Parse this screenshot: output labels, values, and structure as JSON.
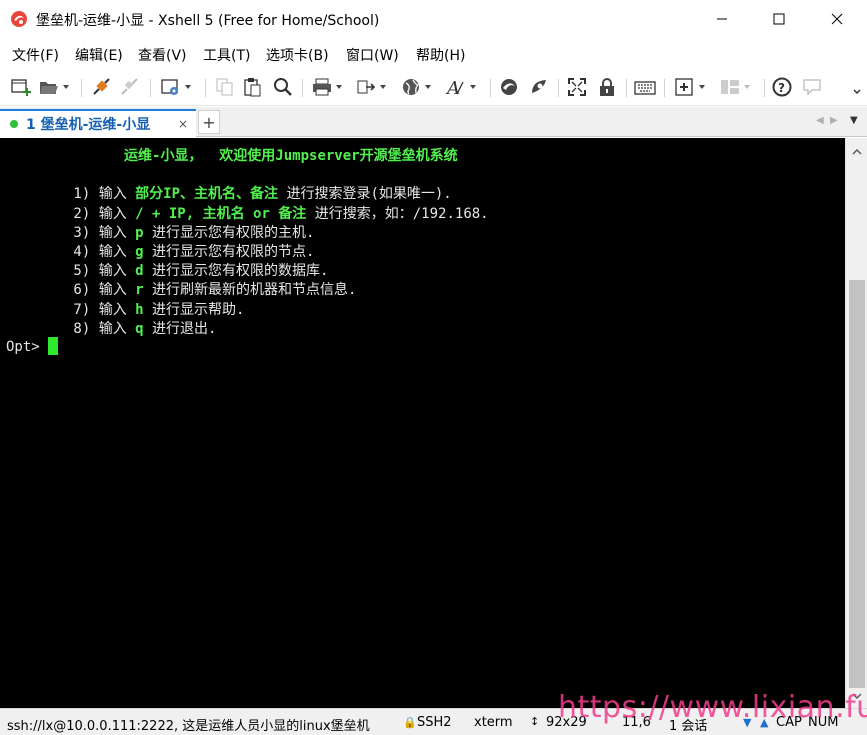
{
  "window": {
    "title": "堡垒机-运维-小显 - Xshell 5 (Free for Home/School)",
    "icon": "xshell-logo-icon"
  },
  "menu": {
    "items": [
      "文件(F)",
      "编辑(E)",
      "查看(V)",
      "工具(T)",
      "选项卡(B)",
      "窗口(W)",
      "帮助(H)"
    ]
  },
  "tabs": {
    "active_label": "1 堡垒机-运维-小显",
    "close_glyph": "×",
    "add_glyph": "+",
    "status_color": "#2dbe3c"
  },
  "terminal": {
    "lines": [
      [
        {
          "t": "              ",
          "h": false
        },
        {
          "t": "运维-小显，  欢迎使用Jumpserver开源堡垒机系统",
          "h": true
        }
      ],
      [],
      [
        {
          "t": "        1) 输入 ",
          "h": false
        },
        {
          "t": "部分IP、主机名、备注",
          "h": true
        },
        {
          "t": " 进行搜索登录(如果唯一).",
          "h": false
        }
      ],
      [
        {
          "t": "        2) 输入 ",
          "h": false
        },
        {
          "t": "/ + IP, 主机名 or 备注",
          "h": true
        },
        {
          "t": " 进行搜索，如：/192.168.",
          "h": false
        }
      ],
      [
        {
          "t": "        3) 输入 ",
          "h": false
        },
        {
          "t": "p",
          "h": true
        },
        {
          "t": " 进行显示您有权限的主机.",
          "h": false
        }
      ],
      [
        {
          "t": "        4) 输入 ",
          "h": false
        },
        {
          "t": "g",
          "h": true
        },
        {
          "t": " 进行显示您有权限的节点.",
          "h": false
        }
      ],
      [
        {
          "t": "        5) 输入 ",
          "h": false
        },
        {
          "t": "d",
          "h": true
        },
        {
          "t": " 进行显示您有权限的数据库.",
          "h": false
        }
      ],
      [
        {
          "t": "        6) 输入 ",
          "h": false
        },
        {
          "t": "r",
          "h": true
        },
        {
          "t": " 进行刷新最新的机器和节点信息.",
          "h": false
        }
      ],
      [
        {
          "t": "        7) 输入 ",
          "h": false
        },
        {
          "t": "h",
          "h": true
        },
        {
          "t": " 进行显示帮助.",
          "h": false
        }
      ],
      [
        {
          "t": "        8) 输入 ",
          "h": false
        },
        {
          "t": "q",
          "h": true
        },
        {
          "t": " 进行退出.",
          "h": false
        }
      ],
      [
        {
          "t": "Opt> ",
          "h": false
        }
      ]
    ],
    "colors": {
      "background": "#000000",
      "foreground": "#e6e6e6",
      "highlight": "#52f04f",
      "cursor": "#2ee82e"
    }
  },
  "status": {
    "connection": "ssh://lx@10.0.0.111:2222, 这是运维人员小显的linux堡垒机",
    "protocol": "SSH2",
    "terminal_type": "xterm",
    "size": "92x29",
    "cursor_pos": "11,6",
    "sessions": "1 会话",
    "caps": "CAP",
    "num": "NUM"
  },
  "watermark": "https://www.lixian.fun"
}
